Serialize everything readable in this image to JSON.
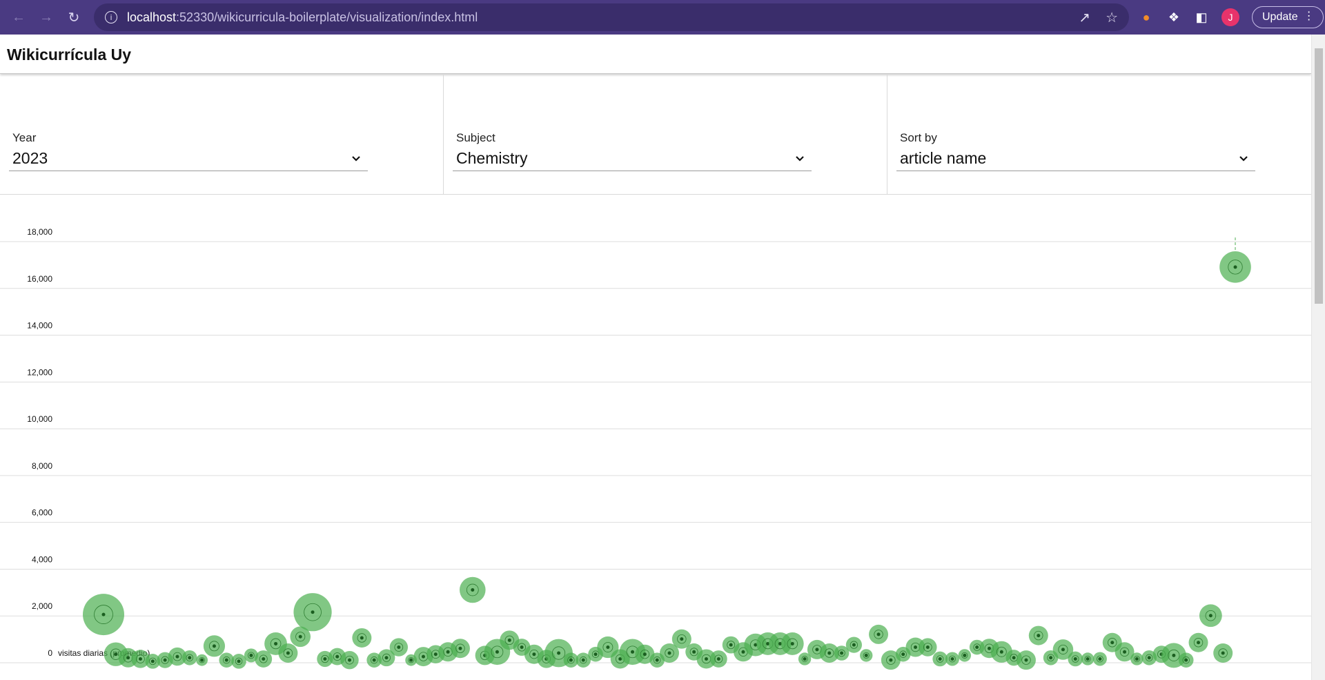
{
  "browser": {
    "url_host": "localhost",
    "url_rest": ":52330/wikicurricula-boilerplate/visualization/index.html",
    "update_label": "Update",
    "avatar_letter": "J",
    "chrome_color": "#4a3a82"
  },
  "app": {
    "title": "Wikicurrícula Uy"
  },
  "filters": [
    {
      "label": "Year",
      "value": "2023"
    },
    {
      "label": "Subject",
      "value": "Chemistry"
    },
    {
      "label": "Sort by",
      "value": "article name"
    }
  ],
  "chart_data": {
    "type": "scatter",
    "ylabel": "visitas diarias (promedio)",
    "ylim": [
      0,
      18000
    ],
    "yticks": [
      "0",
      "2,000",
      "4,000",
      "6,000",
      "8,000",
      "10,000",
      "12,000",
      "14,000",
      "16,000",
      "18,000"
    ],
    "grid": true,
    "color": "#4caf50",
    "points": [
      {
        "x": 1,
        "y": 1650,
        "size": 3
      },
      {
        "x": 2,
        "y": -50,
        "size": 1.4
      },
      {
        "x": 3,
        "y": -200,
        "size": 1.0
      },
      {
        "x": 4,
        "y": -250,
        "size": 0.9
      },
      {
        "x": 5,
        "y": -350,
        "size": 0.6
      },
      {
        "x": 6,
        "y": -300,
        "size": 0.7
      },
      {
        "x": 7,
        "y": -150,
        "size": 0.9
      },
      {
        "x": 8,
        "y": -200,
        "size": 0.6
      },
      {
        "x": 9,
        "y": -300,
        "size": 0.3
      },
      {
        "x": 10,
        "y": 300,
        "size": 1.2
      },
      {
        "x": 11,
        "y": -300,
        "size": 0.6
      },
      {
        "x": 12,
        "y": -350,
        "size": 0.6
      },
      {
        "x": 13,
        "y": -100,
        "size": 0.5
      },
      {
        "x": 14,
        "y": -250,
        "size": 0.8
      },
      {
        "x": 15,
        "y": 400,
        "size": 1.3
      },
      {
        "x": 16,
        "y": 0,
        "size": 1.0
      },
      {
        "x": 17,
        "y": 700,
        "size": 1.1
      },
      {
        "x": 18,
        "y": 1750,
        "size": 2.7
      },
      {
        "x": 19,
        "y": -250,
        "size": 0.7
      },
      {
        "x": 20,
        "y": -150,
        "size": 0.8
      },
      {
        "x": 21,
        "y": -300,
        "size": 0.9
      },
      {
        "x": 22,
        "y": 650,
        "size": 1.0
      },
      {
        "x": 23,
        "y": -300,
        "size": 0.6
      },
      {
        "x": 24,
        "y": -200,
        "size": 0.8
      },
      {
        "x": 25,
        "y": 250,
        "size": 0.9
      },
      {
        "x": 26,
        "y": -300,
        "size": 0.3
      },
      {
        "x": 27,
        "y": -150,
        "size": 1.0
      },
      {
        "x": 28,
        "y": -50,
        "size": 0.9
      },
      {
        "x": 29,
        "y": 50,
        "size": 1.0
      },
      {
        "x": 30,
        "y": 200,
        "size": 1.0
      },
      {
        "x": 31,
        "y": 2700,
        "size": 1.6
      },
      {
        "x": 32,
        "y": -100,
        "size": 1.0
      },
      {
        "x": 33,
        "y": 50,
        "size": 1.6
      },
      {
        "x": 34,
        "y": 550,
        "size": 1.0
      },
      {
        "x": 35,
        "y": 250,
        "size": 0.8
      },
      {
        "x": 36,
        "y": -50,
        "size": 1.0
      },
      {
        "x": 37,
        "y": -250,
        "size": 0.9
      },
      {
        "x": 38,
        "y": 0,
        "size": 1.8
      },
      {
        "x": 39,
        "y": -300,
        "size": 0.6
      },
      {
        "x": 40,
        "y": -300,
        "size": 0.6
      },
      {
        "x": 41,
        "y": -50,
        "size": 0.6
      },
      {
        "x": 42,
        "y": 250,
        "size": 1.2
      },
      {
        "x": 43,
        "y": -250,
        "size": 1.0
      },
      {
        "x": 44,
        "y": 50,
        "size": 1.6
      },
      {
        "x": 45,
        "y": -50,
        "size": 1.0
      },
      {
        "x": 46,
        "y": -300,
        "size": 0.6
      },
      {
        "x": 47,
        "y": 0,
        "size": 1.0
      },
      {
        "x": 48,
        "y": 600,
        "size": 1.0
      },
      {
        "x": 49,
        "y": 50,
        "size": 0.8
      },
      {
        "x": 50,
        "y": -250,
        "size": 1.0
      },
      {
        "x": 51,
        "y": -250,
        "size": 0.8
      },
      {
        "x": 52,
        "y": 350,
        "size": 0.8
      },
      {
        "x": 53,
        "y": 50,
        "size": 1.0
      },
      {
        "x": 54,
        "y": 350,
        "size": 1.3
      },
      {
        "x": 55,
        "y": 400,
        "size": 1.3
      },
      {
        "x": 56,
        "y": 400,
        "size": 1.3
      },
      {
        "x": 57,
        "y": 400,
        "size": 1.3
      },
      {
        "x": 58,
        "y": -250,
        "size": 0.4
      },
      {
        "x": 59,
        "y": 150,
        "size": 1.0
      },
      {
        "x": 60,
        "y": 0,
        "size": 1.0
      },
      {
        "x": 61,
        "y": 0,
        "size": 0.6
      },
      {
        "x": 62,
        "y": 350,
        "size": 0.7
      },
      {
        "x": 63,
        "y": -100,
        "size": 0.4
      },
      {
        "x": 64,
        "y": 800,
        "size": 1.0
      },
      {
        "x": 65,
        "y": -300,
        "size": 1.0
      },
      {
        "x": 66,
        "y": -50,
        "size": 0.6
      },
      {
        "x": 67,
        "y": 250,
        "size": 1.0
      },
      {
        "x": 68,
        "y": 250,
        "size": 0.9
      },
      {
        "x": 69,
        "y": -250,
        "size": 0.6
      },
      {
        "x": 70,
        "y": -250,
        "size": 0.5
      },
      {
        "x": 71,
        "y": -100,
        "size": 0.4
      },
      {
        "x": 72,
        "y": 250,
        "size": 0.6
      },
      {
        "x": 73,
        "y": 200,
        "size": 1.0
      },
      {
        "x": 74,
        "y": 50,
        "size": 1.2
      },
      {
        "x": 75,
        "y": -200,
        "size": 0.7
      },
      {
        "x": 76,
        "y": -300,
        "size": 1.0
      },
      {
        "x": 77,
        "y": 750,
        "size": 1.0
      },
      {
        "x": 78,
        "y": -200,
        "size": 0.6
      },
      {
        "x": 79,
        "y": 150,
        "size": 1.1
      },
      {
        "x": 80,
        "y": -250,
        "size": 0.6
      },
      {
        "x": 81,
        "y": -250,
        "size": 0.4
      },
      {
        "x": 82,
        "y": -250,
        "size": 0.5
      },
      {
        "x": 83,
        "y": 450,
        "size": 1.0
      },
      {
        "x": 84,
        "y": 50,
        "size": 1.0
      },
      {
        "x": 85,
        "y": -250,
        "size": 0.4
      },
      {
        "x": 86,
        "y": -200,
        "size": 0.6
      },
      {
        "x": 87,
        "y": -50,
        "size": 0.8
      },
      {
        "x": 88,
        "y": -100,
        "size": 1.5
      },
      {
        "x": 89,
        "y": -300,
        "size": 0.6
      },
      {
        "x": 90,
        "y": 450,
        "size": 1.0
      },
      {
        "x": 91,
        "y": 1600,
        "size": 1.3
      },
      {
        "x": 92,
        "y": 0,
        "size": 1.0
      },
      {
        "x": 93,
        "y": 16500,
        "size": 2.1
      }
    ]
  }
}
